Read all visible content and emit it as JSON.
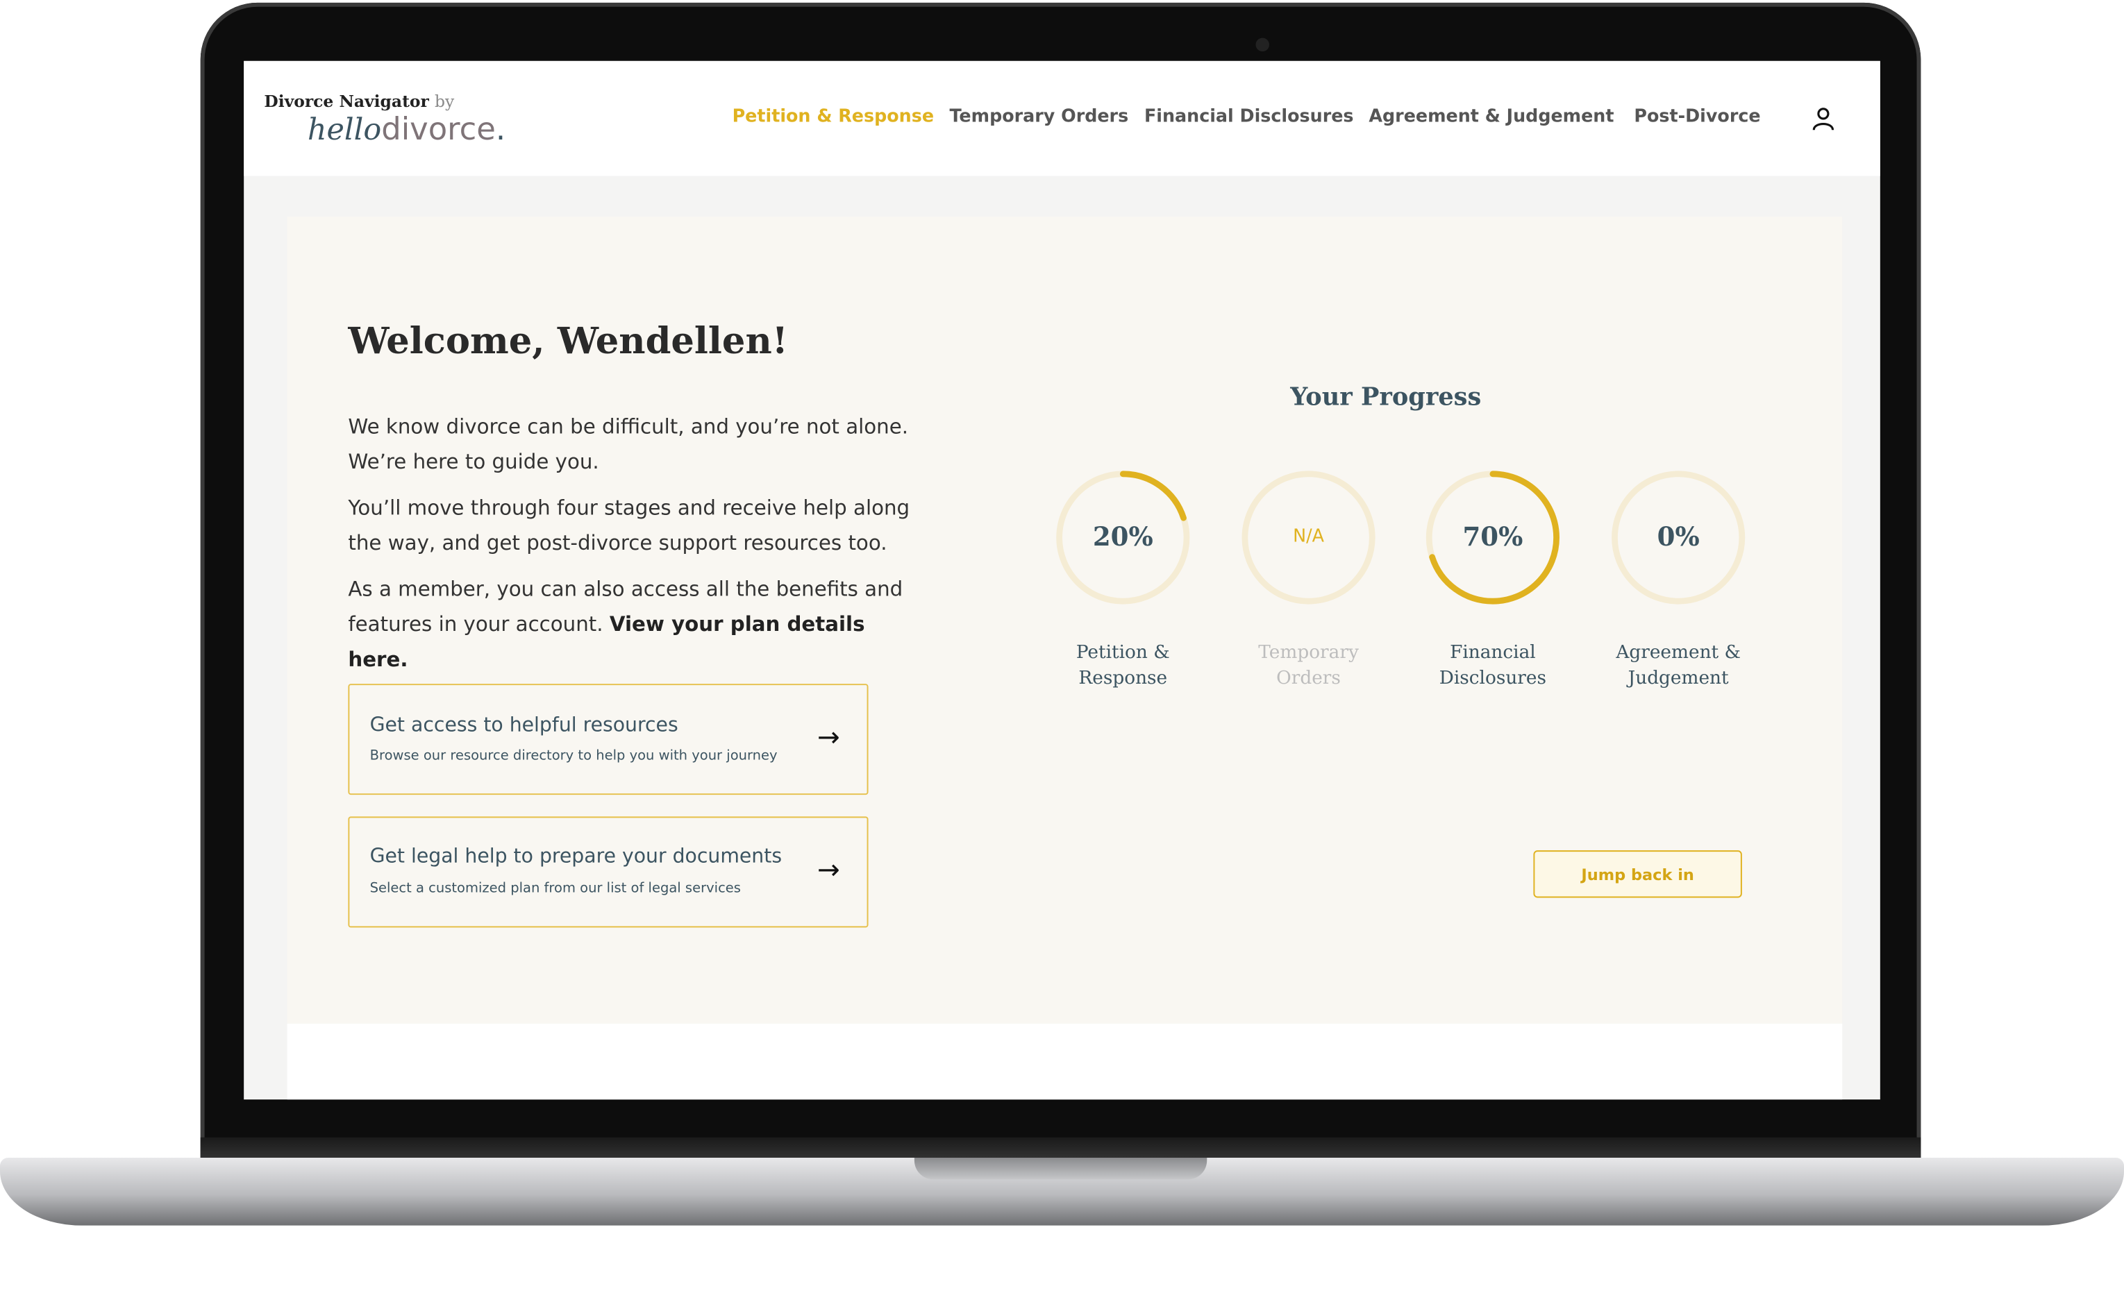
{
  "logo": {
    "title": "Divorce Navigator",
    "by": "by",
    "brand_script": "hello",
    "brand_word": "divorce",
    "brand_dot": "."
  },
  "nav": {
    "items": [
      {
        "label": "Petition & Response",
        "active": true
      },
      {
        "label": "Temporary Orders",
        "active": false
      },
      {
        "label": "Financial Disclosures",
        "active": false
      },
      {
        "label": "Agreement & Judgement",
        "active": false
      },
      {
        "label": "Post-Divorce",
        "active": false
      }
    ],
    "user_icon": "user-icon"
  },
  "welcome": {
    "title": "Welcome, Wendellen!",
    "p1": "We know divorce can be difficult, and you’re not alone. We’re here to guide you.",
    "p2": "You’ll move through four stages and receive help along the way, and get post-divorce support resources too.",
    "p3": "As a member, you can also access all the benefits and features in your account.",
    "p3_link": "View your plan details here."
  },
  "cards": [
    {
      "title": "Get access to helpful resources",
      "subtitle": "Browse our resource directory to help you with your journey",
      "icon": "arrow-right-icon"
    },
    {
      "title": "Get legal help to prepare your documents",
      "subtitle": "Select a customized plan from our list of legal services",
      "icon": "arrow-right-icon"
    }
  ],
  "progress": {
    "title": "Your Progress",
    "stages": [
      {
        "value_label": "20%",
        "percent": 20,
        "label_line1": "Petition &",
        "label_line2": "Response",
        "enabled": true
      },
      {
        "value_label": "N/A",
        "percent": 0,
        "label_line1": "Temporary",
        "label_line2": "Orders",
        "enabled": false
      },
      {
        "value_label": "70%",
        "percent": 70,
        "label_line1": "Financial",
        "label_line2": "Disclosures",
        "enabled": true
      },
      {
        "value_label": "0%",
        "percent": 0,
        "label_line1": "Agreement &",
        "label_line2": "Judgement",
        "enabled": true
      }
    ],
    "jump_label": "Jump back in"
  },
  "colors": {
    "accent": "#e0b220",
    "track": "#f5ecd4",
    "text": "#3c5461",
    "panel": "#f9f7f2"
  }
}
